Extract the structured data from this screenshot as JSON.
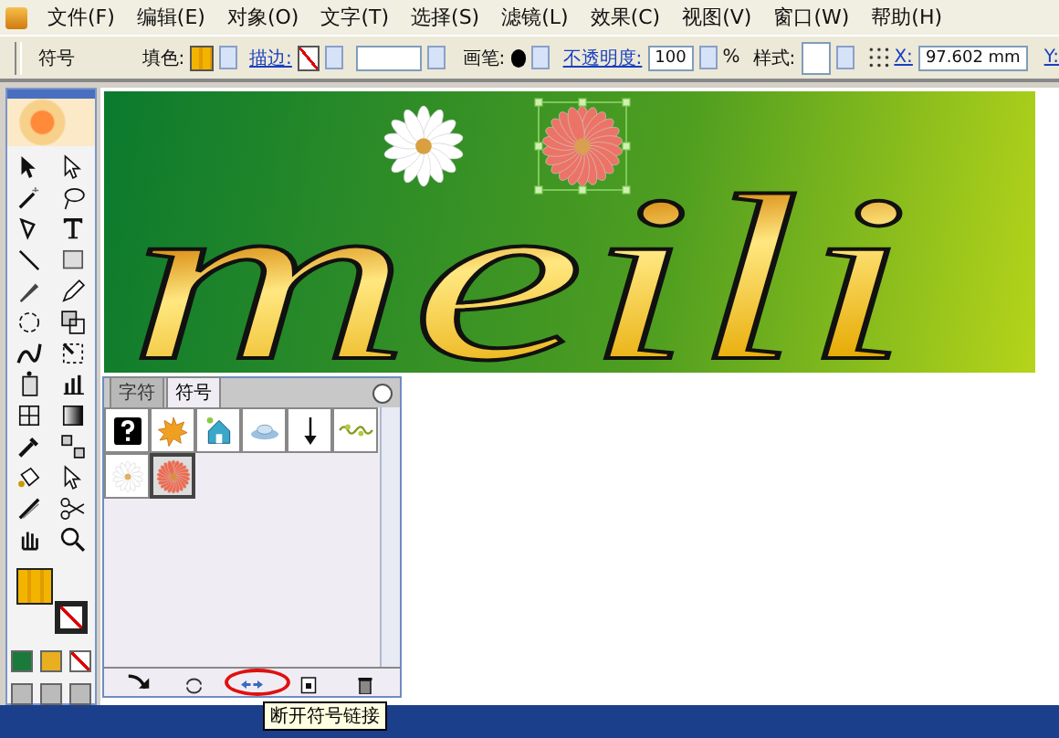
{
  "menu": [
    "文件(F)",
    "编辑(E)",
    "对象(O)",
    "文字(T)",
    "选择(S)",
    "滤镜(L)",
    "效果(C)",
    "视图(V)",
    "窗口(W)",
    "帮助(H)"
  ],
  "options_bar": {
    "panel_label": "符号",
    "fill_label": "填色:",
    "stroke_label": "描边:",
    "brush_label": "画笔:",
    "opacity_label": "不透明度:",
    "opacity_value": "100",
    "percent": "%",
    "style_label": "样式:",
    "x_label": "X:",
    "x_value": "97.602 mm",
    "y_label": "Y:"
  },
  "artwork": {
    "text": "meili"
  },
  "symbols_panel": {
    "tabs": [
      {
        "label": "字符",
        "selected": false
      },
      {
        "label": "符号",
        "selected": true
      }
    ],
    "symbols": [
      {
        "kind": "question",
        "selected": false
      },
      {
        "kind": "leaf",
        "selected": false
      },
      {
        "kind": "house",
        "selected": false
      },
      {
        "kind": "cloud",
        "selected": false
      },
      {
        "kind": "arrow",
        "selected": false
      },
      {
        "kind": "vine",
        "selected": false
      },
      {
        "kind": "daisy",
        "selected": false
      },
      {
        "kind": "red-flower",
        "selected": true
      }
    ],
    "buttons": [
      {
        "kind": "place",
        "circled": false
      },
      {
        "kind": "replace",
        "circled": false
      },
      {
        "kind": "break-link",
        "circled": true
      },
      {
        "kind": "new",
        "circled": false
      },
      {
        "kind": "delete",
        "circled": false
      }
    ],
    "tooltip": "断开符号链接"
  }
}
